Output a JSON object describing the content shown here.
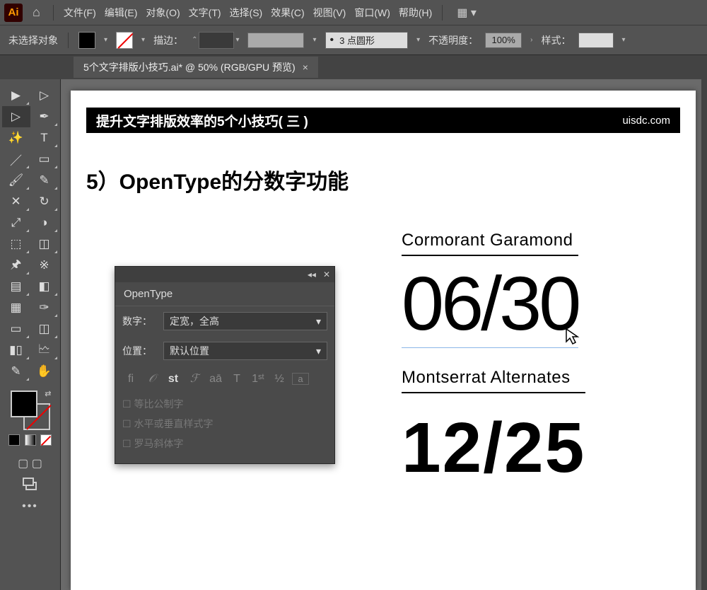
{
  "menubar": {
    "items": [
      "文件(F)",
      "编辑(E)",
      "对象(O)",
      "文字(T)",
      "选择(S)",
      "效果(C)",
      "视图(V)",
      "窗口(W)",
      "帮助(H)"
    ]
  },
  "control": {
    "no_selection": "未选择对象",
    "stroke_label": "描边：",
    "stroke_value": "",
    "dash_value": "3 点圆形",
    "opacity_label": "不透明度：",
    "opacity_value": "100%",
    "style_label": "样式："
  },
  "tab": {
    "title": "5个文字排版小技巧.ai* @ 50% (RGB/GPU 预览)"
  },
  "artboard": {
    "banner_left": "提升文字排版效率的5个小技巧( 三 )",
    "banner_right": "uisdc.com",
    "heading": "5）OpenType的分数字功能",
    "font1_name": "Cormorant Garamond",
    "font1_value": "06/30",
    "font2_name": "Montserrat Alternates",
    "font2_value": "12/25"
  },
  "opentype": {
    "title": "OpenType",
    "row1_label": "数字：",
    "row1_value": "定宽，全高",
    "row2_label": "位置：",
    "row2_value": "默认位置",
    "icons": [
      "fi",
      "𝒪",
      "st",
      "ℱ",
      "aā",
      "T",
      "1ˢᵗ",
      "½",
      "a"
    ],
    "checks": [
      "等比公制字",
      "水平或垂直样式字",
      "罗马斜体字"
    ]
  }
}
